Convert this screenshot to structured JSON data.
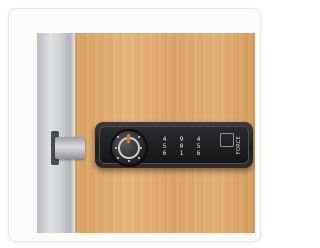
{
  "product_image": {
    "dials": [
      {
        "digits": [
          "4",
          "5",
          "6"
        ]
      },
      {
        "digits": [
          "9",
          "0",
          "1"
        ]
      },
      {
        "digits": [
          "4",
          "5",
          "6"
        ]
      }
    ],
    "brand": "FORCE",
    "knob_indicator_color": "#e07a22",
    "lock_color": "#1e1f21",
    "door_color": "#e0ad72"
  }
}
